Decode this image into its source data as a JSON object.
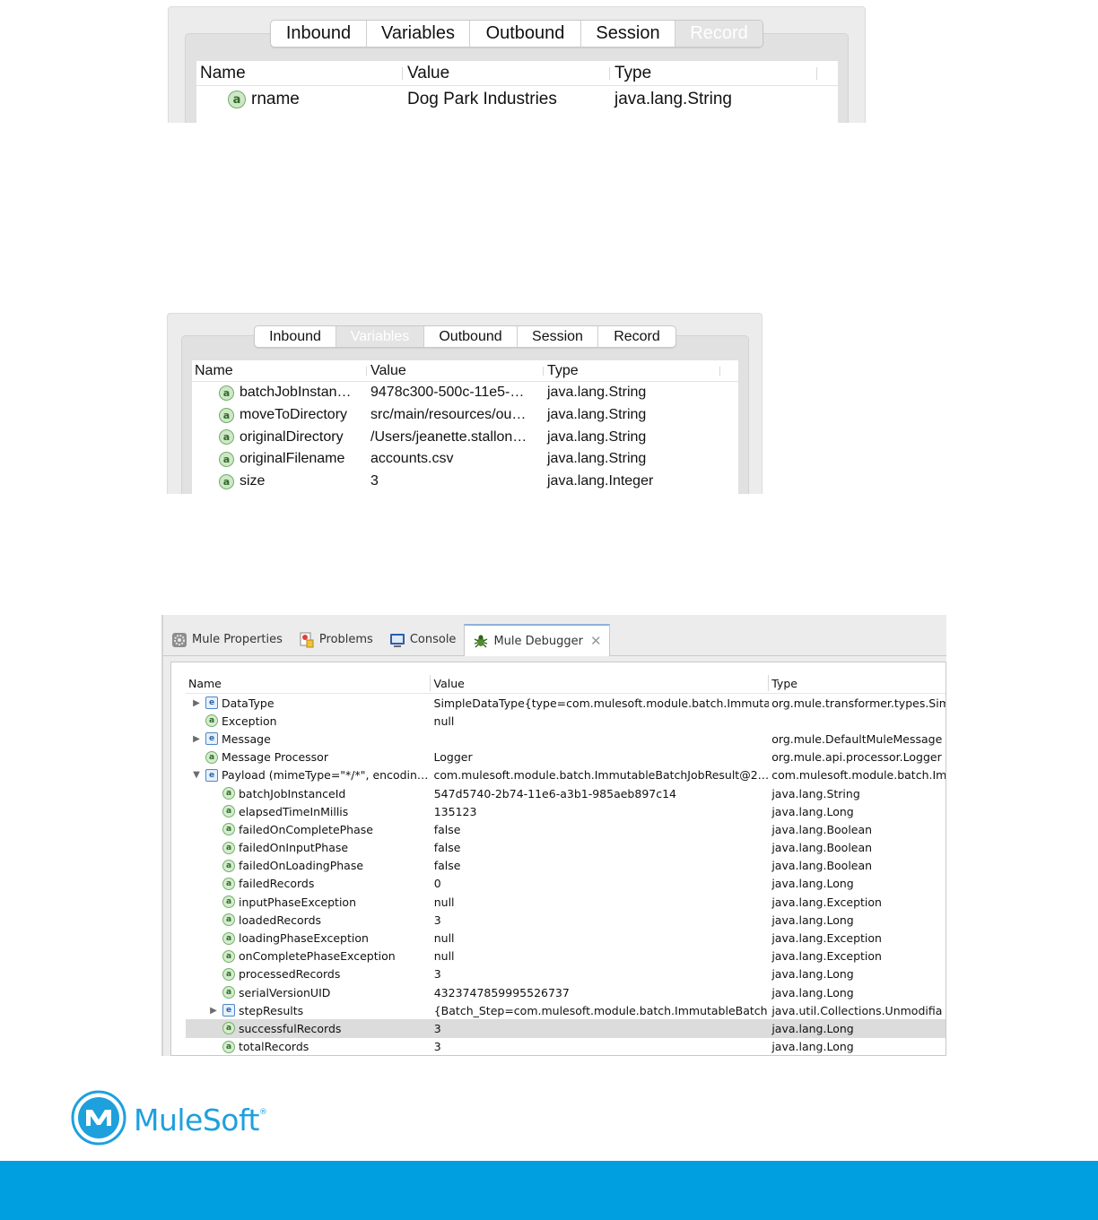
{
  "panel1": {
    "tabs": [
      "Inbound",
      "Variables",
      "Outbound",
      "Session",
      "Record"
    ],
    "active_tab": "Record",
    "columns": [
      "Name",
      "Value",
      "Type"
    ],
    "rows": [
      {
        "icon": "a",
        "name": "rname",
        "value": "Dog Park Industries",
        "type": "java.lang.String"
      }
    ]
  },
  "panel2": {
    "tabs": [
      "Inbound",
      "Variables",
      "Outbound",
      "Session",
      "Record"
    ],
    "active_tab": "Variables",
    "columns": [
      "Name",
      "Value",
      "Type"
    ],
    "rows": [
      {
        "icon": "a",
        "name": "batchJobInstan…",
        "value": "9478c300-500c-11e5-…",
        "type": "java.lang.String"
      },
      {
        "icon": "a",
        "name": "moveToDirectory",
        "value": "src/main/resources/ou…",
        "type": "java.lang.String"
      },
      {
        "icon": "a",
        "name": "originalDirectory",
        "value": "/Users/jeanette.stallon…",
        "type": "java.lang.String"
      },
      {
        "icon": "a",
        "name": "originalFilename",
        "value": "accounts.csv",
        "type": "java.lang.String"
      },
      {
        "icon": "a",
        "name": "size",
        "value": "3",
        "type": "java.lang.Integer"
      }
    ]
  },
  "debugger": {
    "tabs": [
      {
        "label": "Mule Properties",
        "icon": "gear-icon"
      },
      {
        "label": "Problems",
        "icon": "problems-icon"
      },
      {
        "label": "Console",
        "icon": "console-icon"
      },
      {
        "label": "Mule Debugger",
        "icon": "bug-icon"
      }
    ],
    "active_tab": "Mule Debugger",
    "close_glyph": "✕",
    "columns": [
      "Name",
      "Value",
      "Type"
    ],
    "rows": [
      {
        "level": 0,
        "twisty": "▶",
        "icon": "e",
        "name": "DataType",
        "value": "SimpleDataType{type=com.mulesoft.module.batch.Immuta…",
        "type": "org.mule.transformer.types.Sim"
      },
      {
        "level": 0,
        "twisty": "",
        "icon": "a",
        "name": "Exception",
        "value": "null",
        "type": ""
      },
      {
        "level": 0,
        "twisty": "▶",
        "icon": "e",
        "name": "Message",
        "value": "",
        "type": "org.mule.DefaultMuleMessage"
      },
      {
        "level": 0,
        "twisty": "",
        "icon": "a",
        "name": "Message Processor",
        "value": "Logger",
        "type": "org.mule.api.processor.Logger"
      },
      {
        "level": 0,
        "twisty": "▼",
        "icon": "e",
        "name": "Payload (mimeType=\"*/*\", encodin…",
        "value": "com.mulesoft.module.batch.ImmutableBatchJobResult@2…",
        "type": "com.mulesoft.module.batch.Im"
      },
      {
        "level": 1,
        "twisty": "",
        "icon": "a",
        "name": "batchJobInstanceId",
        "value": "547d5740-2b74-11e6-a3b1-985aeb897c14",
        "type": "java.lang.String"
      },
      {
        "level": 1,
        "twisty": "",
        "icon": "a",
        "name": "elapsedTimeInMillis",
        "value": "135123",
        "type": "java.lang.Long"
      },
      {
        "level": 1,
        "twisty": "",
        "icon": "a",
        "name": "failedOnCompletePhase",
        "value": "false",
        "type": "java.lang.Boolean"
      },
      {
        "level": 1,
        "twisty": "",
        "icon": "a",
        "name": "failedOnInputPhase",
        "value": "false",
        "type": "java.lang.Boolean"
      },
      {
        "level": 1,
        "twisty": "",
        "icon": "a",
        "name": "failedOnLoadingPhase",
        "value": "false",
        "type": "java.lang.Boolean"
      },
      {
        "level": 1,
        "twisty": "",
        "icon": "a",
        "name": "failedRecords",
        "value": "0",
        "type": "java.lang.Long"
      },
      {
        "level": 1,
        "twisty": "",
        "icon": "a",
        "name": "inputPhaseException",
        "value": "null",
        "type": "java.lang.Exception"
      },
      {
        "level": 1,
        "twisty": "",
        "icon": "a",
        "name": "loadedRecords",
        "value": "3",
        "type": "java.lang.Long"
      },
      {
        "level": 1,
        "twisty": "",
        "icon": "a",
        "name": "loadingPhaseException",
        "value": "null",
        "type": "java.lang.Exception"
      },
      {
        "level": 1,
        "twisty": "",
        "icon": "a",
        "name": "onCompletePhaseException",
        "value": "null",
        "type": "java.lang.Exception"
      },
      {
        "level": 1,
        "twisty": "",
        "icon": "a",
        "name": "processedRecords",
        "value": "3",
        "type": "java.lang.Long"
      },
      {
        "level": 1,
        "twisty": "",
        "icon": "a",
        "name": "serialVersionUID",
        "value": "4323747859995526737",
        "type": "java.lang.Long"
      },
      {
        "level": 1,
        "twisty": "▶",
        "icon": "e",
        "name": "stepResults",
        "value": "{Batch_Step=com.mulesoft.module.batch.ImmutableBatch…",
        "type": "java.util.Collections.Unmodifia"
      },
      {
        "level": 1,
        "twisty": "",
        "icon": "a",
        "name": "successfulRecords",
        "value": "3",
        "type": "java.lang.Long",
        "selected": true
      },
      {
        "level": 1,
        "twisty": "",
        "icon": "a",
        "name": "totalRecords",
        "value": "3",
        "type": "java.lang.Long"
      }
    ]
  },
  "brand": {
    "name": "MuleSoft",
    "trademark": "®",
    "logo_icon": "mulesoft-logo-icon",
    "color": "#1ea0dc",
    "footer_color": "#009fdf"
  }
}
